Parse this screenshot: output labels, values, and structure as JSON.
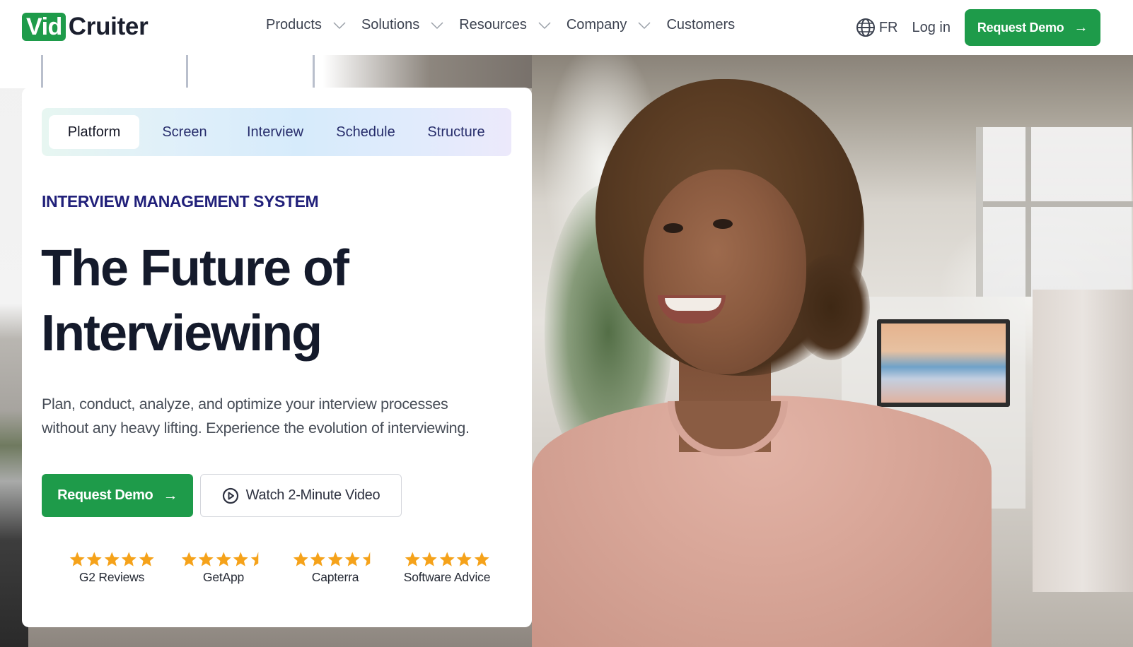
{
  "brand": {
    "logo_part1": "Vid",
    "logo_part2": "Cruiter",
    "accent_color": "#1e9b4a",
    "eyebrow_color": "#21207a"
  },
  "header": {
    "nav": [
      {
        "label": "Products",
        "has_dropdown": true
      },
      {
        "label": "Solutions",
        "has_dropdown": true
      },
      {
        "label": "Resources",
        "has_dropdown": true
      },
      {
        "label": "Company",
        "has_dropdown": true
      },
      {
        "label": "Customers",
        "has_dropdown": false
      }
    ],
    "language": {
      "icon": "globe-icon",
      "label": "FR"
    },
    "login_label": "Log in",
    "cta_label": "Request Demo",
    "cta_icon": "arrow-right-icon"
  },
  "hero": {
    "tabs": [
      {
        "label": "Platform",
        "active": true
      },
      {
        "label": "Screen",
        "active": false
      },
      {
        "label": "Interview",
        "active": false
      },
      {
        "label": "Schedule",
        "active": false
      },
      {
        "label": "Structure",
        "active": false
      }
    ],
    "eyebrow": "INTERVIEW MANAGEMENT SYSTEM",
    "headline_line1": "The Future of",
    "headline_line2": "Interviewing",
    "description_line1": "Plan, conduct, analyze, and optimize your interview processes",
    "description_line2": "without any heavy lifting. Experience the evolution of interviewing.",
    "primary_cta": {
      "label": "Request Demo",
      "icon": "arrow-right-icon"
    },
    "secondary_cta": {
      "label": "Watch 2-Minute Video",
      "icon": "play-circle-icon"
    },
    "image_description": "Smiling woman with curly hair in a pink sweater in a bright office",
    "reviews": [
      {
        "label": "G2 Reviews",
        "rating": 5,
        "star_color": "#f5a21a"
      },
      {
        "label": "GetApp",
        "rating": 4.5,
        "star_color": "#f5a21a"
      },
      {
        "label": "Capterra",
        "rating": 4.5,
        "star_color": "#f5a21a"
      },
      {
        "label": "Software Advice",
        "rating": 5,
        "star_color": "#f5a21a"
      }
    ]
  }
}
